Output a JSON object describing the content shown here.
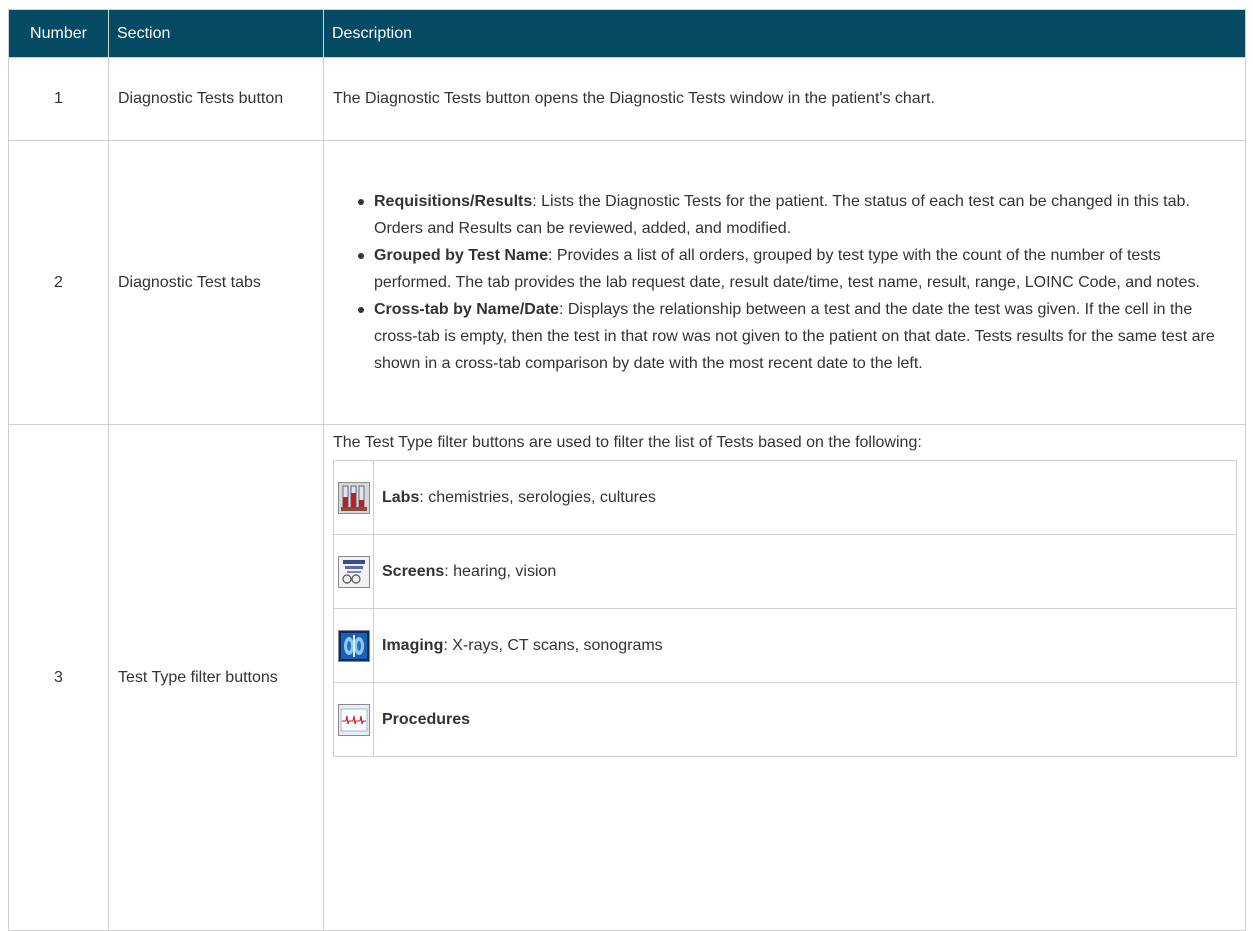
{
  "headers": {
    "number": "Number",
    "section": "Section",
    "description": "Description"
  },
  "rows": [
    {
      "number": "1",
      "section": "Diagnostic Tests button",
      "description": "The Diagnostic Tests button opens the Diagnostic Tests window in the patient's chart."
    },
    {
      "number": "2",
      "section": "Diagnostic Test tabs",
      "items": [
        {
          "label": "Requisitions/Results",
          "text": ": Lists the Diagnostic Tests for the patient. The status of each test can be changed in this tab. Orders and Results can be reviewed, added, and modified."
        },
        {
          "label": "Grouped by Test Name",
          "text": ": Provides a list of all orders, grouped by test type with the count of the number of tests performed. The tab provides the lab request date, result date/time, test name, result, range, LOINC Code, and notes."
        },
        {
          "label": "Cross-tab by Name/Date",
          "text": ": Displays the relationship between a test and the date the test was given. If the cell in the cross-tab is empty, then the test in that row was not given to the patient on that date. Tests results for the same test are shown in a cross-tab comparison by date with the most recent date to the left."
        }
      ]
    },
    {
      "number": "3",
      "section": "Test Type filter buttons",
      "intro": "The Test Type filter buttons are used to filter the list of Tests based on the following:",
      "filters": [
        {
          "icon": "labs-test-tubes-icon",
          "label": "Labs",
          "text": ": chemistries, serologies, cultures"
        },
        {
          "icon": "screens-eye-chart-icon",
          "label": "Screens",
          "text": ": hearing, vision"
        },
        {
          "icon": "imaging-xray-icon",
          "label": "Imaging",
          "text": ": X-rays, CT scans, sonograms"
        },
        {
          "icon": "procedures-ekg-icon",
          "label": "Procedures",
          "text": ""
        }
      ]
    }
  ]
}
